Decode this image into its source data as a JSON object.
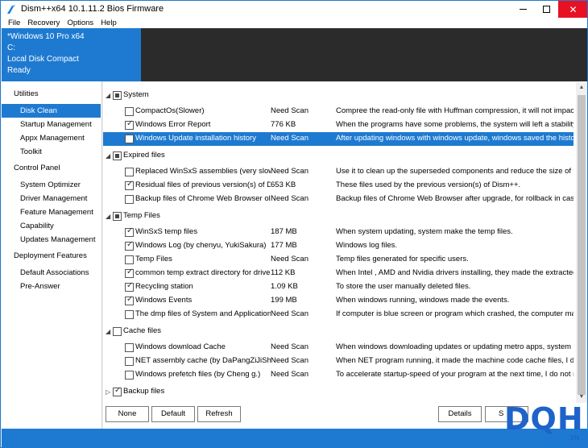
{
  "window": {
    "title": "Dism++x64 10.1.11.2 Bios Firmware",
    "controls": {
      "minimize": "—",
      "maximize": "□",
      "close": "✕"
    }
  },
  "menu": [
    "File",
    "Recovery",
    "Options",
    "Help"
  ],
  "info": {
    "os": "*Windows 10 Pro x64",
    "drive": "C:",
    "disk": "Local Disk Compact",
    "status": "Ready"
  },
  "sidebar": {
    "sections": [
      {
        "title": "Utilities",
        "items": [
          "Disk Clean",
          "Startup Management",
          "Appx Management",
          "Toolkit"
        ]
      },
      {
        "title": "Control Panel",
        "items": [
          "System Optimizer",
          "Driver Management",
          "Feature Management",
          "Capability",
          "Updates Management"
        ]
      },
      {
        "title": "Deployment Features",
        "items": [
          "Default Associations",
          "Pre-Answer"
        ]
      }
    ],
    "active": "Disk Clean"
  },
  "groups": [
    {
      "label": "System",
      "state": "partial",
      "items": [
        {
          "name": "CompactOs(Slower)",
          "size": "Need Scan",
          "desc": "Compree the read-only file with Huffman compression, it will not impact the",
          "checked": false
        },
        {
          "name": "Windows Error Report",
          "size": "776 KB",
          "desc": "When the programs have some problems, the system will left a stability rep",
          "checked": true
        },
        {
          "name": "Windows Update installation history",
          "size": "Need Scan",
          "desc": "After updating windows with windows update, windows saved the history.",
          "checked": false,
          "selected": true
        }
      ]
    },
    {
      "label": "Expired files",
      "state": "partial",
      "items": [
        {
          "name": "Replaced WinSxS assemblies (very slow)",
          "size": "Need Scan",
          "desc": "Use it to clean up the superseded components and reduce the size of the c",
          "checked": false
        },
        {
          "name": "Residual files of previous version(s) of Dism++",
          "size": "653 KB",
          "desc": "These files used by the previous version(s) of Dism++.",
          "checked": true
        },
        {
          "name": "Backup files of Chrome Web Browser old version",
          "size": "Need Scan",
          "desc": "Backup files of Chrome Web Browser after upgrade, for rollback in case of",
          "checked": false
        }
      ]
    },
    {
      "label": "Temp Files",
      "state": "partial",
      "items": [
        {
          "name": "WinSxS temp files",
          "size": "187 MB",
          "desc": "When system updating, system make the temp files.",
          "checked": true
        },
        {
          "name": "Windows Log (by chenyu, YukiSakura)",
          "size": "177 MB",
          "desc": "Windows log files.",
          "checked": true
        },
        {
          "name": "Temp Files",
          "size": "Need Scan",
          "desc": "Temp files generated for specific users.",
          "checked": false
        },
        {
          "name": "common temp extract directory for drivers",
          "size": "112 KB",
          "desc": "When Intel , AMD and Nvidia drivers installing, they made the extracted dire",
          "checked": true
        },
        {
          "name": "Recycling station",
          "size": "1.09 KB",
          "desc": "To store the user manually deleted files.",
          "checked": true
        },
        {
          "name": "Windows Events",
          "size": "199 MB",
          "desc": "When windows running, windows made the events.",
          "checked": true
        },
        {
          "name": "The dmp files of System and Applications (by YukiSakura)",
          "size": "Need Scan",
          "desc": "If computer is blue screen or program which crashed, the computer make d",
          "checked": false
        }
      ]
    },
    {
      "label": "Cache files",
      "state": "unchecked",
      "items": [
        {
          "name": "Windows download Cache",
          "size": "Need Scan",
          "desc": "When windows downloading updates or updating metro apps, system mak",
          "checked": false
        },
        {
          "name": "NET assembly cache (by DaPangZiJiShuYuan)",
          "size": "Need Scan",
          "desc": "When NET program running, it made the machine code cache files, I do no",
          "checked": false
        },
        {
          "name": "Windows prefetch files (by Cheng g.)",
          "size": "Need Scan",
          "desc": "To accelerate startup-speed of your program at the next time, I do not reco",
          "checked": false
        }
      ]
    },
    {
      "label": "Backup files",
      "state": "checked",
      "items": []
    }
  ],
  "buttons": {
    "none": "None",
    "default": "Default",
    "refresh": "Refresh",
    "details": "Details",
    "scan": "S"
  },
  "watermark": {
    "logo": "DQH",
    "sub": ".VN"
  }
}
